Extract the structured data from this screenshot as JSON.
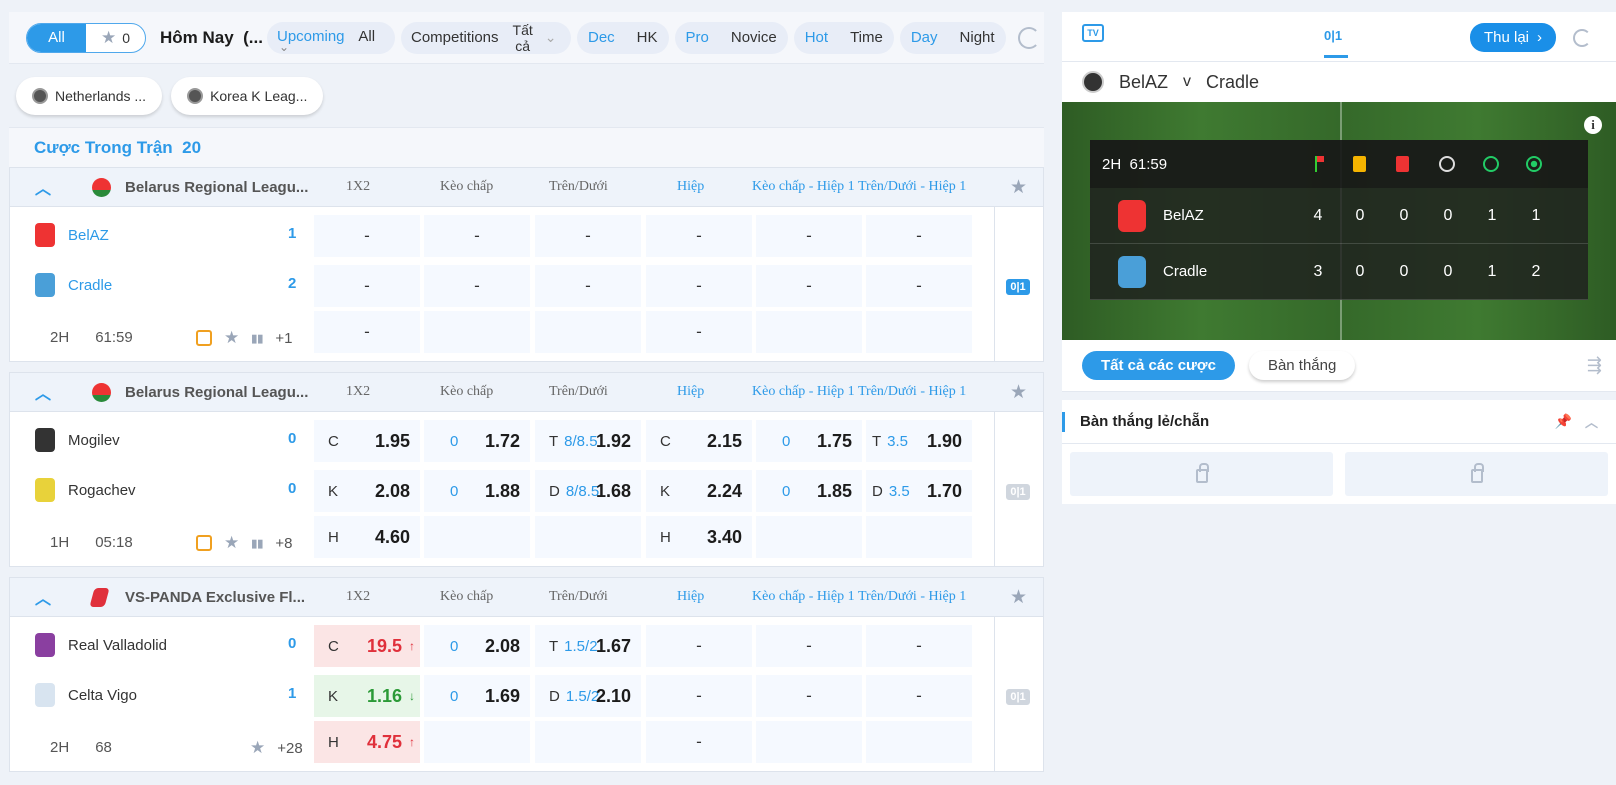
{
  "toolbar": {
    "all": "All",
    "fav_count": "0",
    "today": "Hôm Nay",
    "today_suffix": "(...",
    "upcoming": "Upcoming",
    "upcoming_all": "All",
    "competitions": "Competitions",
    "comp_value_1": "Tất",
    "comp_value_2": "cả",
    "dec": "Dec",
    "hk": "HK",
    "pro": "Pro",
    "novice": "Novice",
    "hot": "Hot",
    "time": "Time",
    "day": "Day",
    "night": "Night"
  },
  "chips": [
    "Netherlands ...",
    "Korea K Leag..."
  ],
  "section": {
    "title": "Cược Trong Trận",
    "count": "20"
  },
  "columns": {
    "c1": "1X2",
    "c2": "Kèo chấp",
    "c3": "Trên/Dưới",
    "c4": "Hiệp",
    "c5": "Kèo chấp - Hiệp 1",
    "c6": "Trên/Dưới - Hiệp 1"
  },
  "leagues": [
    {
      "name": "Belarus Regional Leagu...",
      "home": "BelAZ",
      "away": "Cradle",
      "home_score": "1",
      "away_score": "2",
      "period": "2H",
      "clock": "61:59",
      "more": "+1",
      "r1": [
        "-",
        "-",
        "-",
        "-",
        "-",
        "-"
      ],
      "r2": [
        "-",
        "-",
        "-",
        "-",
        "-",
        "-"
      ],
      "r3": [
        "-",
        "-"
      ]
    },
    {
      "name": "Belarus Regional Leagu...",
      "home": "Mogilev",
      "away": "Rogachev",
      "home_score": "0",
      "away_score": "0",
      "period": "1H",
      "clock": "05:18",
      "more": "+8",
      "r1": {
        "x": "C",
        "xv": "1.95",
        "h": "0",
        "hv": "1.72",
        "o": "T",
        "ol": "8/8.5",
        "ov": "1.92",
        "p": "C",
        "pv": "2.15",
        "h1": "0",
        "h1v": "1.75",
        "o1": "T",
        "o1l": "3.5",
        "o1v": "1.90"
      },
      "r2": {
        "x": "K",
        "xv": "2.08",
        "h": "0",
        "hv": "1.88",
        "o": "D",
        "ol": "8/8.5",
        "ov": "1.68",
        "p": "K",
        "pv": "2.24",
        "h1": "0",
        "h1v": "1.85",
        "o1": "D",
        "o1l": "3.5",
        "o1v": "1.70"
      },
      "r3": {
        "x": "H",
        "xv": "4.60",
        "p": "H",
        "pv": "3.40"
      }
    },
    {
      "name": "VS-PANDA Exclusive Fl...",
      "home": "Real Valladolid",
      "away": "Celta Vigo",
      "home_score": "0",
      "away_score": "1",
      "period": "2H",
      "clock": "68",
      "more": "+28",
      "r1": {
        "x": "C",
        "xv": "19.5",
        "h": "0",
        "hv": "2.08",
        "o": "T",
        "ol": "1.5/2",
        "ov": "1.67",
        "d": "-"
      },
      "r2": {
        "x": "K",
        "xv": "1.16",
        "h": "0",
        "hv": "1.69",
        "o": "D",
        "ol": "1.5/2",
        "ov": "2.10",
        "d": "-"
      },
      "r3": {
        "x": "H",
        "xv": "4.75",
        "d": "-"
      }
    }
  ],
  "live_badge": "0|1",
  "right": {
    "hide": "Thu lại",
    "home": "BelAZ",
    "vs": "v",
    "away": "Cradle",
    "sb_period": "2H",
    "sb_clock": "61:59",
    "sb_rows": [
      {
        "team": "BelAZ",
        "vals": [
          "4",
          "0",
          "0",
          "0",
          "1",
          "1"
        ]
      },
      {
        "team": "Cradle",
        "vals": [
          "3",
          "0",
          "0",
          "0",
          "1",
          "2"
        ]
      }
    ],
    "tab_all": "Tất cả các cược",
    "tab_goals": "Bàn thắng",
    "odd_even": "Bàn thắng lẻ/chẵn"
  },
  "colors": {
    "accent": "#2d9ae8",
    "up": "#e0303b",
    "down": "#2b9a37"
  }
}
